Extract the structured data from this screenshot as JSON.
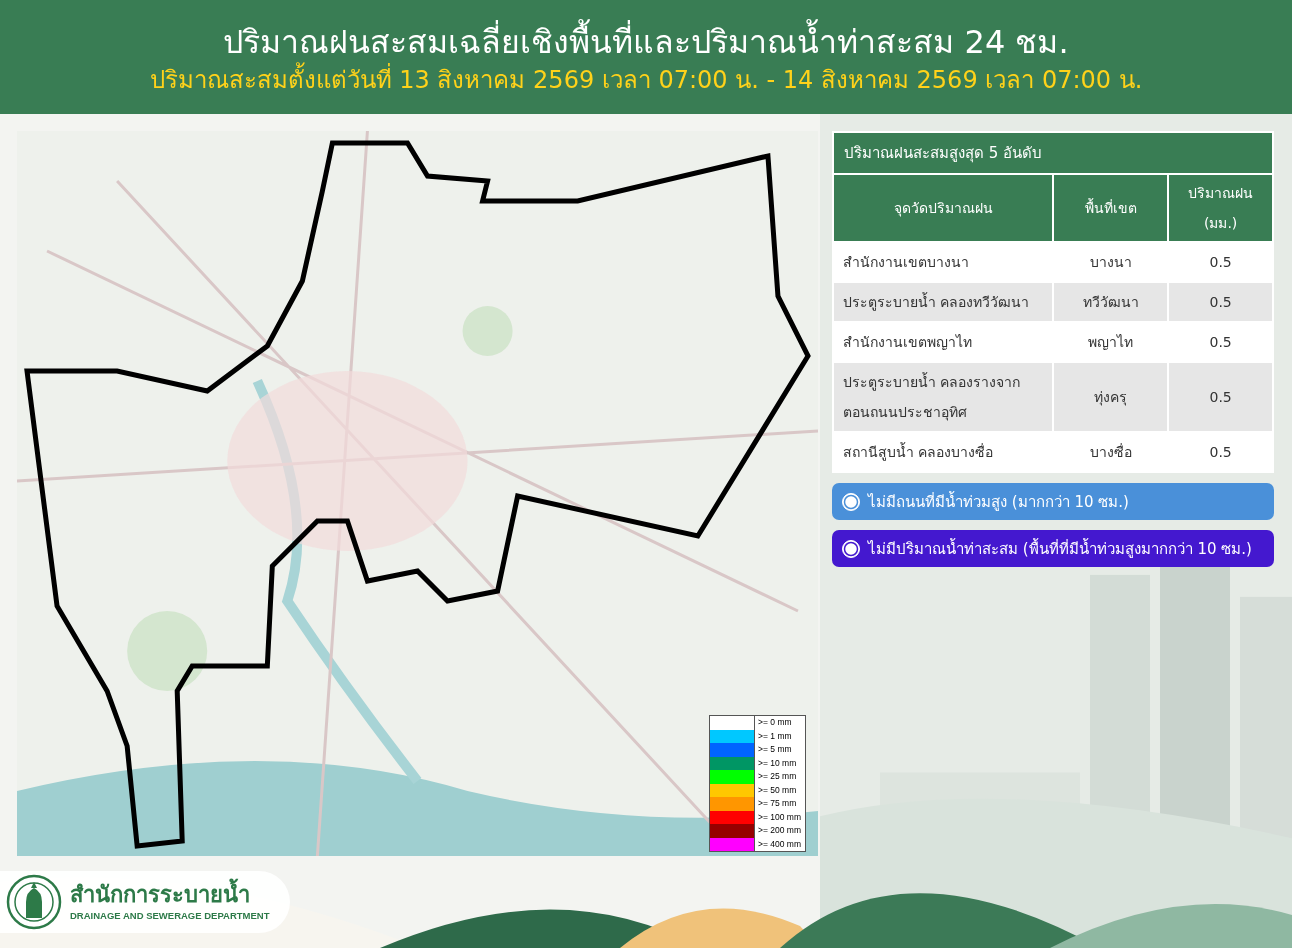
{
  "header": {
    "title": "ปริมาณฝนสะสมเฉลี่ยเชิงพื้นที่และปริมาณน้ำท่าสะสม 24 ชม.",
    "subtitle": "ปริมาณสะสมตั้งแต่วันที่ 13 สิงหาคม 2569 เวลา 07:00 น. - 14 สิงหาคม 2569 เวลา 07:00 น."
  },
  "map": {
    "legend": [
      {
        "label": ">= 0  mm",
        "color": "#ffffff"
      },
      {
        "label": ">= 1 mm",
        "color": "#00c8ff"
      },
      {
        "label": ">= 5 mm",
        "color": "#0064ff"
      },
      {
        "label": ">= 10 mm",
        "color": "#009664"
      },
      {
        "label": ">= 25 mm",
        "color": "#00ff00"
      },
      {
        "label": ">= 50 mm",
        "color": "#ffc800"
      },
      {
        "label": ">= 75 mm",
        "color": "#ff9600"
      },
      {
        "label": ">= 100 mm",
        "color": "#ff0000"
      },
      {
        "label": ">= 200 mm",
        "color": "#960000"
      },
      {
        "label": ">= 400 mm",
        "color": "#ff00ff"
      }
    ]
  },
  "ranking": {
    "title": "ปริมาณฝนสะสมสูงสุด 5 อันดับ",
    "columns": [
      "จุดวัดปริมาณฝน",
      "พื้นที่เขต",
      "ปริมาณฝน\n(มม.)"
    ],
    "rows": [
      [
        "สำนักงานเขตบางนา",
        "บางนา",
        "0.5"
      ],
      [
        "ประตูระบายน้ำ คลองทวีวัฒนา",
        "ทวีวัฒนา",
        "0.5"
      ],
      [
        "สำนักงานเขตพญาไท",
        "พญาไท",
        "0.5"
      ],
      [
        "ประตูระบายน้ำ คลองรางจาก\nตอนถนนประชาอุทิศ",
        "ทุ่งครุ",
        "0.5"
      ],
      [
        "สถานีสูบน้ำ คลองบางซื่อ",
        "บางซื่อ",
        "0.5"
      ]
    ]
  },
  "notices": [
    {
      "text": "ไม่มีถนนที่มีน้ำท่วมสูง (มากกว่า 10 ซม.)",
      "color": "#4a90d9"
    },
    {
      "text": "ไม่มีปริมาณน้ำท่าสะสม (พื้นที่ที่มีน้ำท่วมสูงมากกว่า 10 ซม.)",
      "color": "#4418cf"
    }
  ],
  "footer": {
    "org_name": "สำนักการระบายน้ำ",
    "org_name_en": "DRAINAGE AND SEWERAGE DEPARTMENT"
  }
}
